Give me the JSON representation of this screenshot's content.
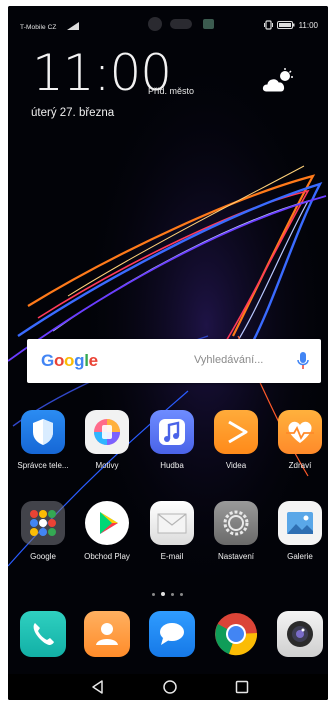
{
  "status": {
    "carrier": "T-Mobile CZ",
    "time": "11:00"
  },
  "lockclock": {
    "time": "11:00",
    "city": "Příd. město",
    "date": "úterý 27. března"
  },
  "search": {
    "logo": "Google",
    "placeholder": "Vyhledávání..."
  },
  "row1": [
    {
      "label": "Správce tele...",
      "icon": "shield-icon"
    },
    {
      "label": "Motivy",
      "icon": "themes-icon"
    },
    {
      "label": "Hudba",
      "icon": "music-icon"
    },
    {
      "label": "Videa",
      "icon": "video-icon"
    },
    {
      "label": "Zdraví",
      "icon": "health-icon"
    }
  ],
  "row2": [
    {
      "label": "Google",
      "icon": "google-folder-icon"
    },
    {
      "label": "Obchod Play",
      "icon": "play-store-icon"
    },
    {
      "label": "E-mail",
      "icon": "email-icon"
    },
    {
      "label": "Nastavení",
      "icon": "settings-icon"
    },
    {
      "label": "Galerie",
      "icon": "gallery-icon"
    }
  ],
  "dock": [
    "phone-icon",
    "contacts-icon",
    "messages-icon",
    "chrome-icon",
    "camera-icon"
  ],
  "pager": {
    "pages": 4,
    "current": 2
  },
  "nav": [
    "back-icon",
    "home-icon",
    "recents-icon"
  ]
}
